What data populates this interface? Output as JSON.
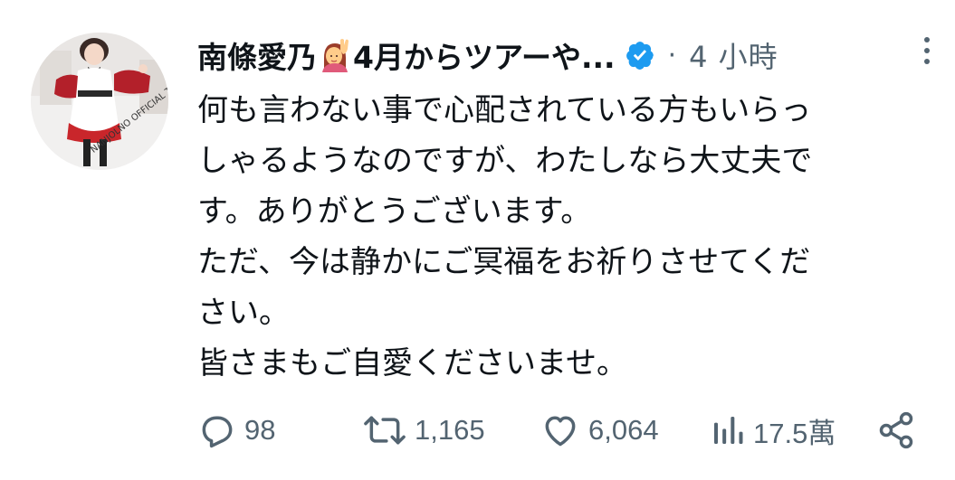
{
  "header": {
    "display_name_prefix": "南條愛乃",
    "display_name_suffix": "4月からツアーや...",
    "separator": "·",
    "time": "4 小時"
  },
  "icons": {
    "emoji": "raising-hand-emoji",
    "verified": "verified-badge-icon",
    "more": "more-vertical-icon",
    "reply": "reply-icon",
    "retweet": "retweet-icon",
    "like": "like-icon",
    "views": "views-icon",
    "share": "share-icon"
  },
  "tweet": {
    "lines": [
      "何も言わない事で心配されている方もいらっ",
      "しゃるようなのですが、わたしなら大丈夫で",
      "す。ありがとうございます。",
      "ただ、今は静かにご冥福をお祈りさせてくだ",
      "さい。",
      "皆さまもご自愛くださいませ。"
    ]
  },
  "actions": {
    "reply_count": "98",
    "retweet_count": "1,165",
    "like_count": "6,064",
    "views_count": "17.5萬"
  },
  "avatar": {
    "text": "NANJOLNO OFFICIAL TWITTER"
  },
  "colors": {
    "text": "#0f1419",
    "secondary": "#536471",
    "verified": "#1d9bf0"
  }
}
